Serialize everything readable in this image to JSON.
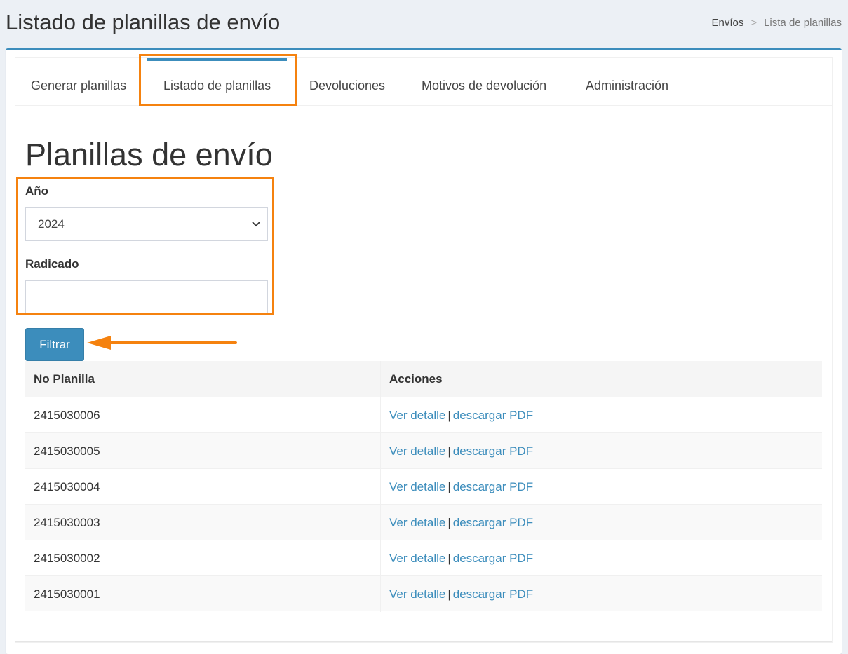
{
  "header": {
    "title": "Listado de planillas de envío",
    "breadcrumb": {
      "parent": "Envíos",
      "separator": ">",
      "current": "Lista de planillas"
    }
  },
  "tabs": [
    {
      "label": "Generar planillas",
      "active": false
    },
    {
      "label": "Listado de planillas",
      "active": true
    },
    {
      "label": "Devoluciones",
      "active": false
    },
    {
      "label": "Motivos de devolución",
      "active": false
    },
    {
      "label": "Administración",
      "active": false
    }
  ],
  "content": {
    "section_title": "Planillas de envío",
    "year_label": "Año",
    "year_value": "2024",
    "radicado_label": "Radicado",
    "radicado_value": "",
    "filter_button": "Filtrar"
  },
  "table": {
    "headers": [
      "No Planilla",
      "Acciones"
    ],
    "rows": [
      {
        "number": "2415030006",
        "view": "Ver detalle",
        "sep": "|",
        "download": "descargar PDF"
      },
      {
        "number": "2415030005",
        "view": "Ver detalle",
        "sep": "|",
        "download": "descargar PDF"
      },
      {
        "number": "2415030004",
        "view": "Ver detalle",
        "sep": "|",
        "download": "descargar PDF"
      },
      {
        "number": "2415030003",
        "view": "Ver detalle",
        "sep": "|",
        "download": "descargar PDF"
      },
      {
        "number": "2415030002",
        "view": "Ver detalle",
        "sep": "|",
        "download": "descargar PDF"
      },
      {
        "number": "2415030001",
        "view": "Ver detalle",
        "sep": "|",
        "download": "descargar PDF"
      }
    ]
  },
  "colors": {
    "accent": "#3c8dbc",
    "annotation": "#f5820f",
    "background": "#ecf0f5"
  },
  "icons": {
    "select_chevron": "chevron-down-icon",
    "annotation_arrow": "arrow-left-icon"
  }
}
